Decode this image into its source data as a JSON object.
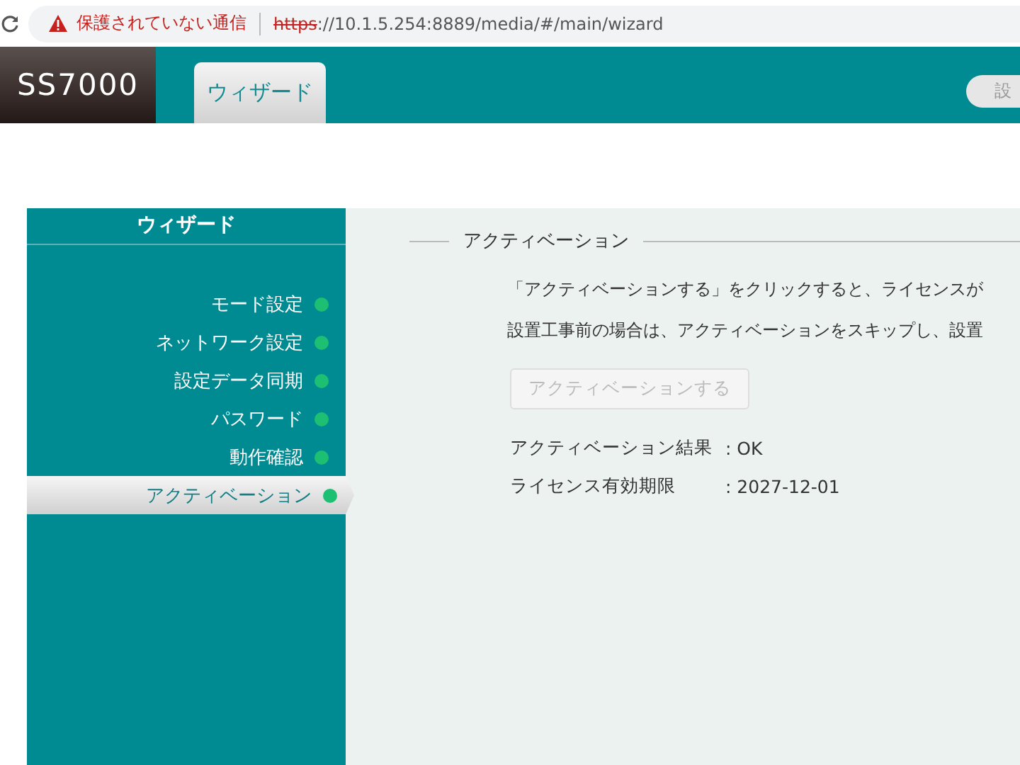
{
  "browser": {
    "security_warning": "保護されていない通信",
    "url_scheme": "https",
    "url_rest": "://10.1.5.254:8889/media/#/main/wizard"
  },
  "header": {
    "logo": "SS7000",
    "tabs": [
      {
        "label": "ウィザード",
        "selected": true
      }
    ],
    "right_button": "設"
  },
  "sidebar": {
    "title": "ウィザード",
    "items": [
      {
        "label": "モード設定",
        "selected": false,
        "color": "#1dbf73"
      },
      {
        "label": "ネットワーク設定",
        "selected": false,
        "color": "#1dbf73"
      },
      {
        "label": "設定データ同期",
        "selected": false,
        "color": "#1dbf73"
      },
      {
        "label": "パスワード",
        "selected": false,
        "color": "#1dbf73"
      },
      {
        "label": "動作確認",
        "selected": false,
        "color": "#1dbf73"
      },
      {
        "label": "アクティベーション",
        "selected": true,
        "color": "#1dbf73"
      }
    ]
  },
  "content": {
    "section_title": "アクティベーション",
    "paragraphs": [
      "「アクティベーションする」をクリックすると、ライセンスが",
      "設置工事前の場合は、アクティベーションをスキップし、設置"
    ],
    "activate_button": {
      "label": "アクティベーションする",
      "disabled": true
    },
    "results": [
      {
        "label": "アクティベーション結果",
        "value": ": OK"
      },
      {
        "label": "ライセンス有効期限",
        "value": ": 2027-12-01"
      }
    ]
  }
}
